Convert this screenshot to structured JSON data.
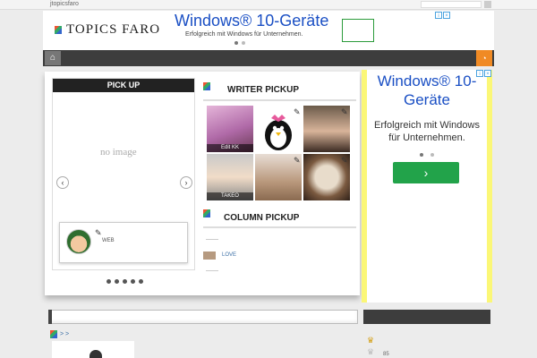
{
  "topbar": {
    "site_name": "jtopicsfaro"
  },
  "header": {
    "logo_text": "TOPICS FARO",
    "ad": {
      "title": "Windows® 10-Geräte",
      "subtitle": "Erfolgreich mit Windows für Unternehmen."
    }
  },
  "nav": {
    "home_icon": "home-icon",
    "rss_icon": "rss-icon"
  },
  "pickup": {
    "heading": "PICK UP",
    "placeholder": "no image",
    "card_label": "WEB",
    "prev": "‹",
    "next": "›"
  },
  "writer_pickup": {
    "heading": "WRITER PICKUP",
    "writers": [
      {
        "label": "Edit KK"
      },
      {
        "label": ""
      },
      {
        "label": ""
      },
      {
        "label": "TAKEO"
      },
      {
        "label": ""
      },
      {
        "label": ""
      }
    ]
  },
  "column_pickup": {
    "heading": "COLUMN PICKUP",
    "items": [
      {
        "label": "LOVE"
      }
    ]
  },
  "side_ad": {
    "title": "Windows® 10-Geräte",
    "subtitle": "Erfolgreich mit Windows für Unternehmen.",
    "button": "›"
  },
  "lower": {
    "breadcrumb": "> >",
    "rank_count": "85"
  },
  "colors": {
    "accent_blue": "#1a4fc4",
    "nav_dark": "#3d3d3d",
    "rss_orange": "#f08a24",
    "ad_button": "#22a34a",
    "ad_border": "#fbf777"
  }
}
